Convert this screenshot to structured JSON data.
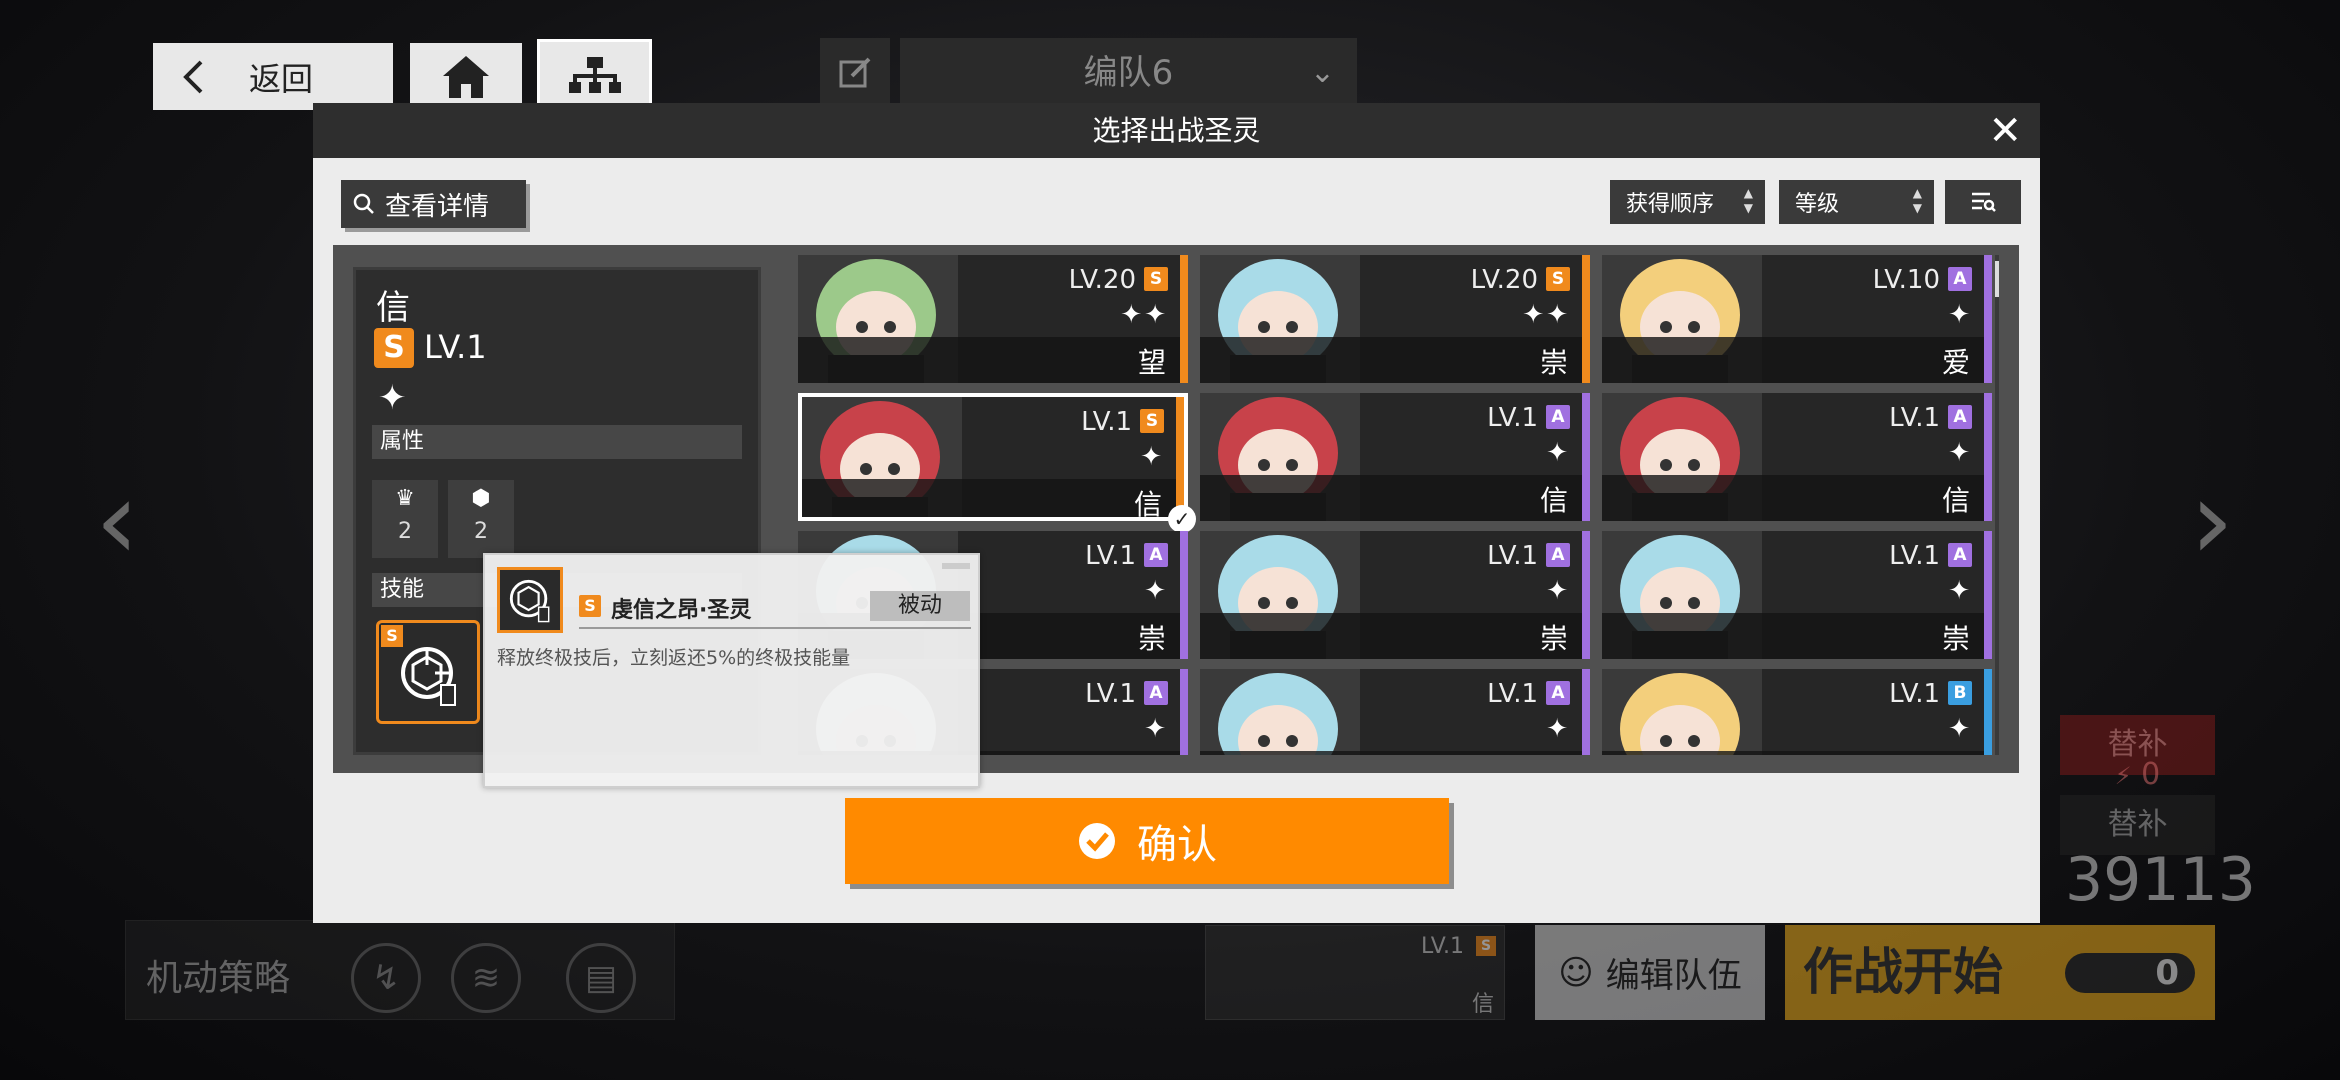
{
  "nav": {
    "back_label": "返回"
  },
  "team_select": {
    "label": "编队6"
  },
  "modal": {
    "title": "选择出战圣灵",
    "view_detail_label": "查看详情",
    "sort_order_label": "获得顺序",
    "sort_by_label": "等级",
    "confirm_label": "确认"
  },
  "detail": {
    "name": "信",
    "rank": "S",
    "level": "LV.1",
    "stars": "✦",
    "attr_section_label": "属性",
    "attrs": [
      {
        "icon": "crown-icon",
        "value": "2"
      },
      {
        "icon": "hexagon-icon",
        "value": "2"
      }
    ],
    "skill_section_label": "技能",
    "skill_rank": "S"
  },
  "tooltip": {
    "rank": "S",
    "name": "虔信之昂·圣灵",
    "type": "被动",
    "description": "释放终极技后，立刻返还5%的终极技能量"
  },
  "cards": [
    {
      "level": "LV.20",
      "rank": "S",
      "stars": "✦✦",
      "name": "望",
      "rank_color": "#f08a1d",
      "hair": "green"
    },
    {
      "level": "LV.20",
      "rank": "S",
      "stars": "✦✦",
      "name": "崇",
      "rank_color": "#f08a1d",
      "hair": "blue"
    },
    {
      "level": "LV.10",
      "rank": "A",
      "stars": "✦",
      "name": "爱",
      "rank_color": "#a070e0",
      "hair": "blonde"
    },
    {
      "level": "LV.1",
      "rank": "S",
      "stars": "✦",
      "name": "信",
      "rank_color": "#f08a1d",
      "hair": "red",
      "selected": true
    },
    {
      "level": "LV.1",
      "rank": "A",
      "stars": "✦",
      "name": "信",
      "rank_color": "#a070e0",
      "hair": "red"
    },
    {
      "level": "LV.1",
      "rank": "A",
      "stars": "✦",
      "name": "信",
      "rank_color": "#a070e0",
      "hair": "red"
    },
    {
      "level": "LV.1",
      "rank": "A",
      "stars": "✦",
      "name": "崇",
      "rank_color": "#a070e0",
      "hair": "blue"
    },
    {
      "level": "LV.1",
      "rank": "A",
      "stars": "✦",
      "name": "崇",
      "rank_color": "#a070e0",
      "hair": "blue"
    },
    {
      "level": "LV.1",
      "rank": "A",
      "stars": "✦",
      "name": "崇",
      "rank_color": "#a070e0",
      "hair": "blue"
    },
    {
      "level": "LV.1",
      "rank": "A",
      "stars": "✦",
      "name": "",
      "rank_color": "#a070e0",
      "hair": "white"
    },
    {
      "level": "LV.1",
      "rank": "A",
      "stars": "✦",
      "name": "",
      "rank_color": "#a070e0",
      "hair": "blue"
    },
    {
      "level": "LV.1",
      "rank": "B",
      "stars": "✦",
      "name": "",
      "rank_color": "#3a9ee0",
      "hair": "blonde"
    }
  ],
  "background": {
    "strategy_label": "机动策略",
    "edit_team_label": "编辑队伍",
    "start_label": "作战开始",
    "start_count": "0",
    "reserve_label_1": "替补",
    "reserve_value_1": "0",
    "reserve_label_2": "替补",
    "score": "39113",
    "bg_card_level": "LV.1",
    "bg_card_rank": "S",
    "bg_card_name": "信"
  },
  "colors": {
    "accent_orange": "#ff8a00",
    "rank_s": "#f08a1d",
    "rank_a": "#a070e0",
    "rank_b": "#3a9ee0"
  }
}
